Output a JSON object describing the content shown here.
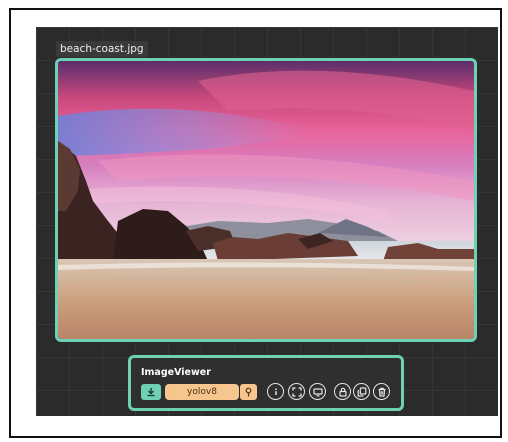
{
  "file": {
    "name": "beach-coast.jpg"
  },
  "panel": {
    "title": "ImageViewer",
    "model": "yolov8"
  },
  "icons": {
    "download": "download-icon",
    "pin": "pin-icon",
    "info": "info-icon",
    "fullscreen": "fullscreen-icon",
    "display": "display-icon",
    "lock": "lock-icon",
    "copy": "copy-icon",
    "delete": "trash-icon"
  },
  "colors": {
    "accent": "#6fd1b4",
    "model_pill": "#f7c58e",
    "canvas": "#2b2b2b"
  }
}
